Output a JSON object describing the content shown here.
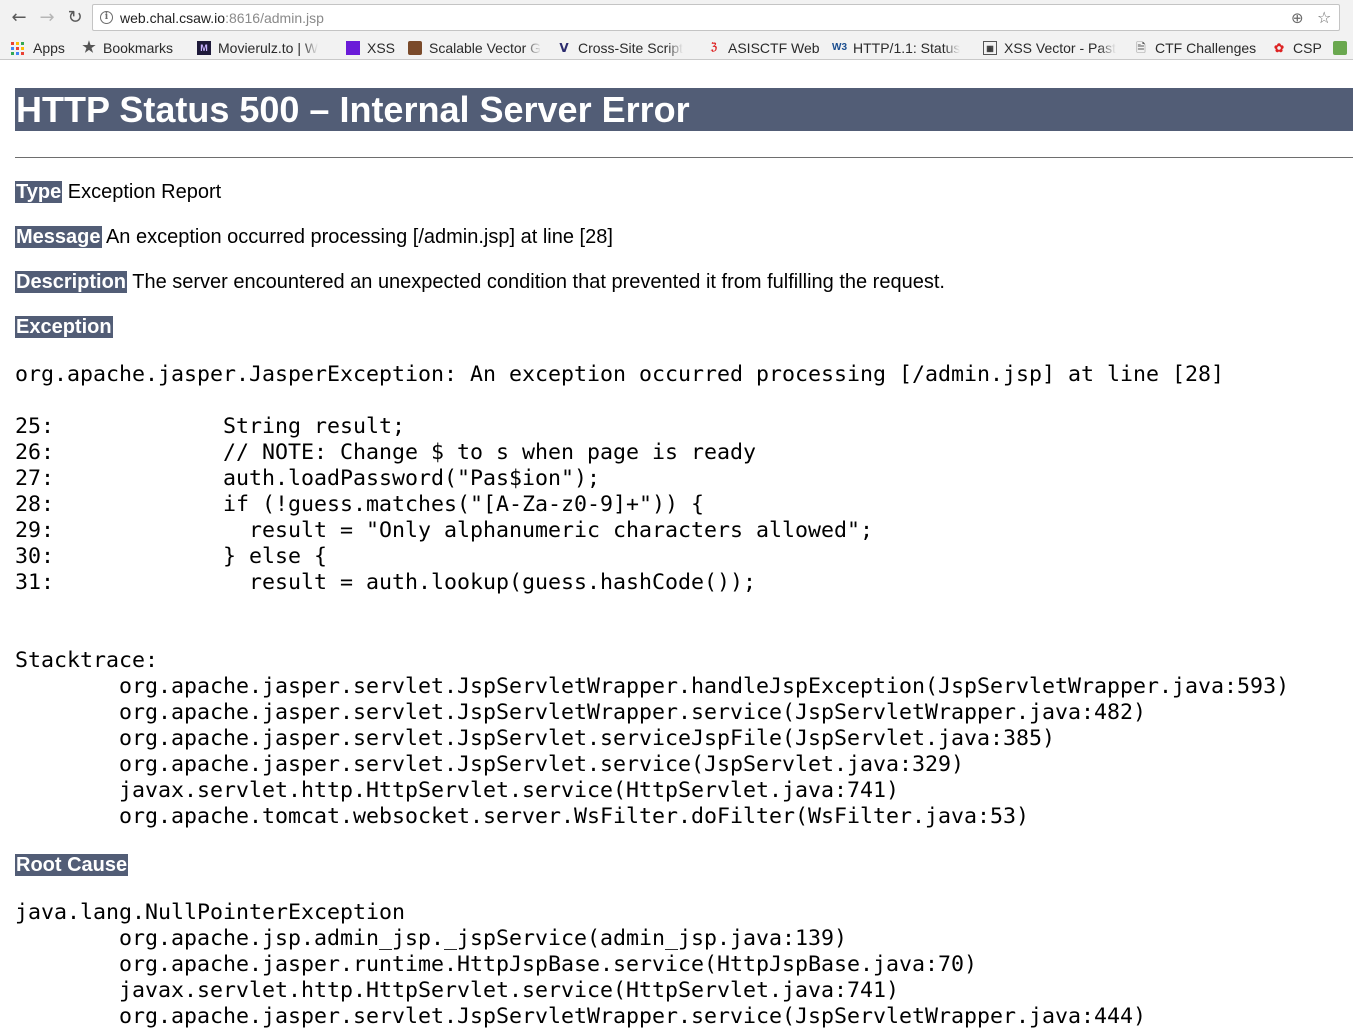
{
  "browser": {
    "url_host": "web.chal.csaw.io",
    "url_rest": ":8616/admin.jsp",
    "bookmarks": [
      {
        "label": "Apps"
      },
      {
        "label": "Bookmarks"
      },
      {
        "label": "Movierulz.to | W"
      },
      {
        "label": "XSS"
      },
      {
        "label": "Scalable Vector G"
      },
      {
        "label": "Cross-Site Script"
      },
      {
        "label": "ASISCTF Web"
      },
      {
        "label": "HTTP/1.1: Status"
      },
      {
        "label": "XSS Vector - Past"
      },
      {
        "label": "CTF Challenges"
      },
      {
        "label": "CSP"
      }
    ]
  },
  "page": {
    "title": "HTTP Status 500 – Internal Server Error",
    "type_label": "Type",
    "type_value": "Exception Report",
    "message_label": "Message",
    "message_value": "An exception occurred processing [/admin.jsp] at line [28]",
    "description_label": "Description",
    "description_value": "The server encountered an unexpected condition that prevented it from fulfilling the request.",
    "exception_label": "Exception",
    "exception_text": "org.apache.jasper.JasperException: An exception occurred processing [/admin.jsp] at line [28]\n\n25:\t\tString result;\n26:\t\t// NOTE: Change $ to s when page is ready\n27:\t\tauth.loadPassword(\"Pas$ion\");\n28:\t\tif (!guess.matches(\"[A-Za-z0-9]+\")) {\n29:\t\t  result = \"Only alphanumeric characters allowed\";\n30:\t\t} else {\n31:\t\t  result = auth.lookup(guess.hashCode());\n\n\nStacktrace:\n\torg.apache.jasper.servlet.JspServletWrapper.handleJspException(JspServletWrapper.java:593)\n\torg.apache.jasper.servlet.JspServletWrapper.service(JspServletWrapper.java:482)\n\torg.apache.jasper.servlet.JspServlet.serviceJspFile(JspServlet.java:385)\n\torg.apache.jasper.servlet.JspServlet.service(JspServlet.java:329)\n\tjavax.servlet.http.HttpServlet.service(HttpServlet.java:741)\n\torg.apache.tomcat.websocket.server.WsFilter.doFilter(WsFilter.java:53)",
    "root_cause_label": "Root Cause",
    "root_cause_text": "java.lang.NullPointerException\n\torg.apache.jsp.admin_jsp._jspService(admin_jsp.java:139)\n\torg.apache.jasper.runtime.HttpJspBase.service(HttpJspBase.java:70)\n\tjavax.servlet.http.HttpServlet.service(HttpServlet.java:741)\n\torg.apache.jasper.servlet.JspServletWrapper.service(JspServletWrapper.java:444)"
  },
  "colors": {
    "heading_bg": "#525d76",
    "heading_fg": "#ffffff"
  }
}
